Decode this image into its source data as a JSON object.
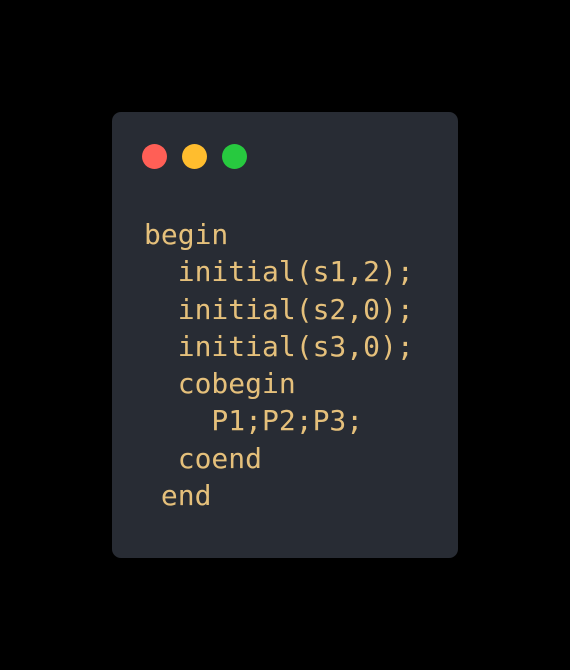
{
  "window": {
    "background": "#282c34",
    "controls": [
      {
        "name": "close",
        "color": "#ff5f56"
      },
      {
        "name": "minimize",
        "color": "#ffbd2e"
      },
      {
        "name": "maximize",
        "color": "#27c93f"
      }
    ]
  },
  "code": {
    "color": "#e5c07b",
    "lines": [
      "begin",
      "  initial(s1,2);",
      "  initial(s2,0);",
      "  initial(s3,0);",
      "  cobegin",
      "    P1;P2;P3;",
      "  coend",
      " end"
    ]
  }
}
